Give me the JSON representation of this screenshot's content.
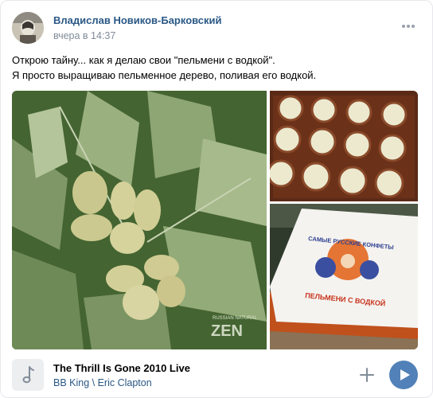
{
  "post": {
    "author": "Владислав Новиков-Барковский",
    "time": "вчера в 14:37",
    "text_lines": [
      "Открою тайну... как я делаю свои \"пельмени с водкой\".",
      "Я просто выращиваю пельменное дерево, поливая его водкой."
    ],
    "photos": {
      "main_watermark": "ZEN",
      "main_watermark_top": "RUSSIAN NATURAL",
      "box_title": "САМЫЕ РУССКИЕ КОНФЕТЫ",
      "box_subtitle": "ПЕЛЬМЕНИ С ВОДКОЙ"
    }
  },
  "audio": {
    "title": "The Thrill Is Gone 2010 Live",
    "artist": "BB King \\ Eric Clapton",
    "icon": "music-note-icon"
  },
  "colors": {
    "link": "#2a5885",
    "secondary": "#818c99",
    "accent": "#5181b8"
  }
}
